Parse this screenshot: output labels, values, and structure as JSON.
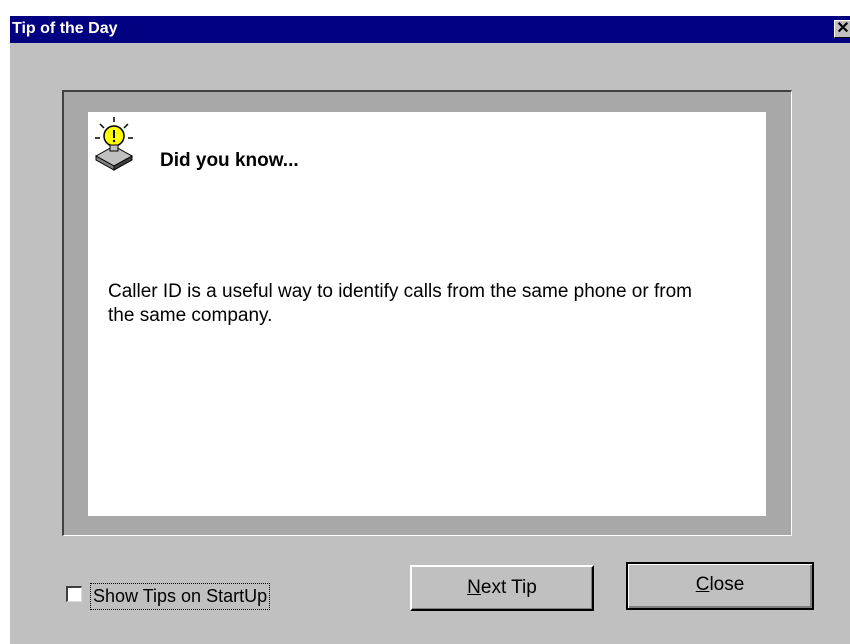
{
  "window": {
    "title": "Tip of the Day",
    "close_glyph": "✕"
  },
  "content": {
    "heading": "Did you know...",
    "tip_text": "Caller ID is a useful way to identify calls from the same phone or from the same company.",
    "icon": "lightbulb-icon"
  },
  "footer": {
    "show_tips_label": "Show Tips on StartUp",
    "show_tips_checked": false,
    "next_tip_mnemonic": "N",
    "next_tip_rest": "ext Tip",
    "close_mnemonic": "C",
    "close_rest": "lose"
  },
  "colors": {
    "titlebar": "#000080",
    "dialog_bg": "#c0c0c0",
    "content_bg": "#ffffff"
  }
}
